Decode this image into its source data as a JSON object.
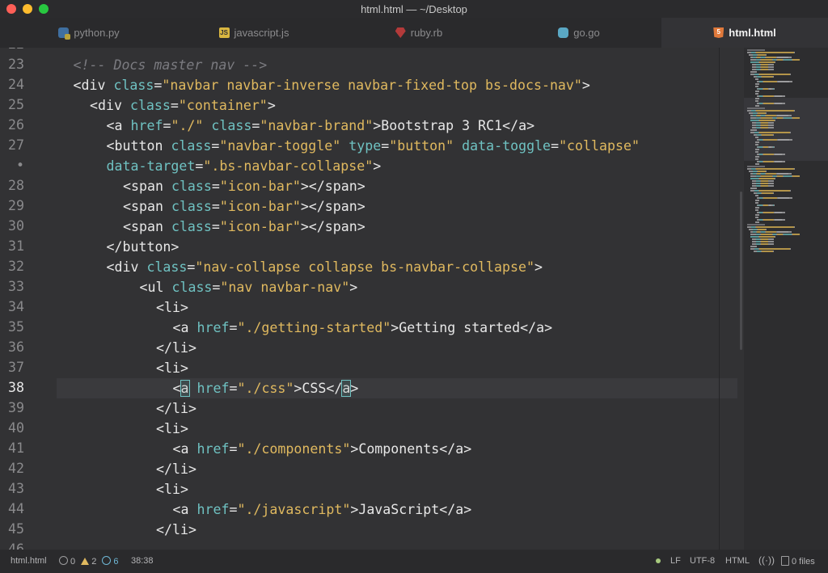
{
  "window": {
    "title": "html.html — ~/Desktop"
  },
  "tabs": [
    {
      "label": "python.py",
      "icon": "python-file-icon",
      "active": false
    },
    {
      "label": "javascript.js",
      "icon": "javascript-file-icon",
      "active": false
    },
    {
      "label": "ruby.rb",
      "icon": "ruby-file-icon",
      "active": false
    },
    {
      "label": "go.go",
      "icon": "go-file-icon",
      "active": false
    },
    {
      "label": "html.html",
      "icon": "html5-file-icon",
      "active": true
    }
  ],
  "editor": {
    "lines": [
      {
        "num": "23",
        "tokens": [
          [
            "comment",
            "<!-- Docs master nav -->"
          ]
        ],
        "indent": 1
      },
      {
        "num": "24",
        "tokens": [
          [
            "tag",
            "<div "
          ],
          [
            "attr",
            "class"
          ],
          [
            "tag",
            "="
          ],
          [
            "str",
            "\"navbar navbar-inverse navbar-fixed-top bs-docs-nav\""
          ],
          [
            "tag",
            ">"
          ]
        ],
        "indent": 1
      },
      {
        "num": "25",
        "tokens": [
          [
            "tag",
            "<div "
          ],
          [
            "attr",
            "class"
          ],
          [
            "tag",
            "="
          ],
          [
            "str",
            "\"container\""
          ],
          [
            "tag",
            ">"
          ]
        ],
        "indent": 2
      },
      {
        "num": "26",
        "tokens": [
          [
            "tag",
            "<a "
          ],
          [
            "attr",
            "href"
          ],
          [
            "tag",
            "="
          ],
          [
            "str",
            "\"./\""
          ],
          [
            "tag",
            " "
          ],
          [
            "attr",
            "class"
          ],
          [
            "tag",
            "="
          ],
          [
            "str",
            "\"navbar-brand\""
          ],
          [
            "tag",
            ">"
          ],
          [
            "text",
            "Bootstrap 3 RC1"
          ],
          [
            "tag",
            "</a>"
          ]
        ],
        "indent": 3
      },
      {
        "num": "27",
        "tokens": [
          [
            "tag",
            "<button "
          ],
          [
            "attr",
            "class"
          ],
          [
            "tag",
            "="
          ],
          [
            "str",
            "\"navbar-toggle\""
          ],
          [
            "tag",
            " "
          ],
          [
            "attr",
            "type"
          ],
          [
            "tag",
            "="
          ],
          [
            "str",
            "\"button\""
          ],
          [
            "tag",
            " "
          ],
          [
            "attr",
            "data-toggle"
          ],
          [
            "tag",
            "="
          ],
          [
            "str",
            "\"collapse\""
          ]
        ],
        "indent": 3
      },
      {
        "num": "•",
        "tokens": [
          [
            "attr",
            "data-target"
          ],
          [
            "tag",
            "="
          ],
          [
            "str",
            "\".bs-navbar-collapse\""
          ],
          [
            "tag",
            ">"
          ]
        ],
        "indent": 3
      },
      {
        "num": "28",
        "tokens": [
          [
            "tag",
            "<span "
          ],
          [
            "attr",
            "class"
          ],
          [
            "tag",
            "="
          ],
          [
            "str",
            "\"icon-bar\""
          ],
          [
            "tag",
            "></span>"
          ]
        ],
        "indent": 4
      },
      {
        "num": "29",
        "tokens": [
          [
            "tag",
            "<span "
          ],
          [
            "attr",
            "class"
          ],
          [
            "tag",
            "="
          ],
          [
            "str",
            "\"icon-bar\""
          ],
          [
            "tag",
            "></span>"
          ]
        ],
        "indent": 4
      },
      {
        "num": "30",
        "tokens": [
          [
            "tag",
            "<span "
          ],
          [
            "attr",
            "class"
          ],
          [
            "tag",
            "="
          ],
          [
            "str",
            "\"icon-bar\""
          ],
          [
            "tag",
            "></span>"
          ]
        ],
        "indent": 4
      },
      {
        "num": "31",
        "tokens": [
          [
            "tag",
            "</button>"
          ]
        ],
        "indent": 3
      },
      {
        "num": "32",
        "tokens": [
          [
            "tag",
            "<div "
          ],
          [
            "attr",
            "class"
          ],
          [
            "tag",
            "="
          ],
          [
            "str",
            "\"nav-collapse collapse bs-navbar-collapse\""
          ],
          [
            "tag",
            ">"
          ]
        ],
        "indent": 3
      },
      {
        "num": "33",
        "tokens": [
          [
            "tag",
            "<ul "
          ],
          [
            "attr",
            "class"
          ],
          [
            "tag",
            "="
          ],
          [
            "str",
            "\"nav navbar-nav\""
          ],
          [
            "tag",
            ">"
          ]
        ],
        "indent": 5
      },
      {
        "num": "34",
        "tokens": [
          [
            "tag",
            "<li>"
          ]
        ],
        "indent": 6
      },
      {
        "num": "35",
        "tokens": [
          [
            "tag",
            "<a "
          ],
          [
            "attr",
            "href"
          ],
          [
            "tag",
            "="
          ],
          [
            "str",
            "\"./getting-started\""
          ],
          [
            "tag",
            ">"
          ],
          [
            "text",
            "Getting started"
          ],
          [
            "tag",
            "</a>"
          ]
        ],
        "indent": 7
      },
      {
        "num": "36",
        "tokens": [
          [
            "tag",
            "</li>"
          ]
        ],
        "indent": 6
      },
      {
        "num": "37",
        "tokens": [
          [
            "tag",
            "<li>"
          ]
        ],
        "indent": 6
      },
      {
        "num": "38",
        "tokens": [
          [
            "tag",
            "<"
          ],
          [
            "match",
            "a"
          ],
          [
            "tag",
            " "
          ],
          [
            "attr",
            "href"
          ],
          [
            "tag",
            "="
          ],
          [
            "str",
            "\"./css\""
          ],
          [
            "tag",
            ">"
          ],
          [
            "text",
            "CSS"
          ],
          [
            "tag",
            "</"
          ],
          [
            "match",
            "a"
          ],
          [
            "tag",
            ">"
          ]
        ],
        "indent": 7,
        "current": true
      },
      {
        "num": "39",
        "tokens": [
          [
            "tag",
            "</li>"
          ]
        ],
        "indent": 6
      },
      {
        "num": "40",
        "tokens": [
          [
            "tag",
            "<li>"
          ]
        ],
        "indent": 6
      },
      {
        "num": "41",
        "tokens": [
          [
            "tag",
            "<a "
          ],
          [
            "attr",
            "href"
          ],
          [
            "tag",
            "="
          ],
          [
            "str",
            "\"./components\""
          ],
          [
            "tag",
            ">"
          ],
          [
            "text",
            "Components"
          ],
          [
            "tag",
            "</a>"
          ]
        ],
        "indent": 7
      },
      {
        "num": "42",
        "tokens": [
          [
            "tag",
            "</li>"
          ]
        ],
        "indent": 6
      },
      {
        "num": "43",
        "tokens": [
          [
            "tag",
            "<li>"
          ]
        ],
        "indent": 6
      },
      {
        "num": "44",
        "tokens": [
          [
            "tag",
            "<a "
          ],
          [
            "attr",
            "href"
          ],
          [
            "tag",
            "="
          ],
          [
            "str",
            "\"./javascript\""
          ],
          [
            "tag",
            ">"
          ],
          [
            "text",
            "JavaScript"
          ],
          [
            "tag",
            "</a>"
          ]
        ],
        "indent": 7
      },
      {
        "num": "45",
        "tokens": [
          [
            "tag",
            "</li>"
          ]
        ],
        "indent": 6
      }
    ]
  },
  "statusbar": {
    "filename": "html.html",
    "errors": "0",
    "warnings": "2",
    "infos": "6",
    "cursor": "38:38",
    "line_ending": "LF",
    "encoding": "UTF-8",
    "grammar": "HTML",
    "git_files": "0 files"
  },
  "colors": {
    "accent": "#6fc2c2",
    "string": "#e0b95f",
    "comment": "#7b7b80",
    "background": "#323234"
  }
}
